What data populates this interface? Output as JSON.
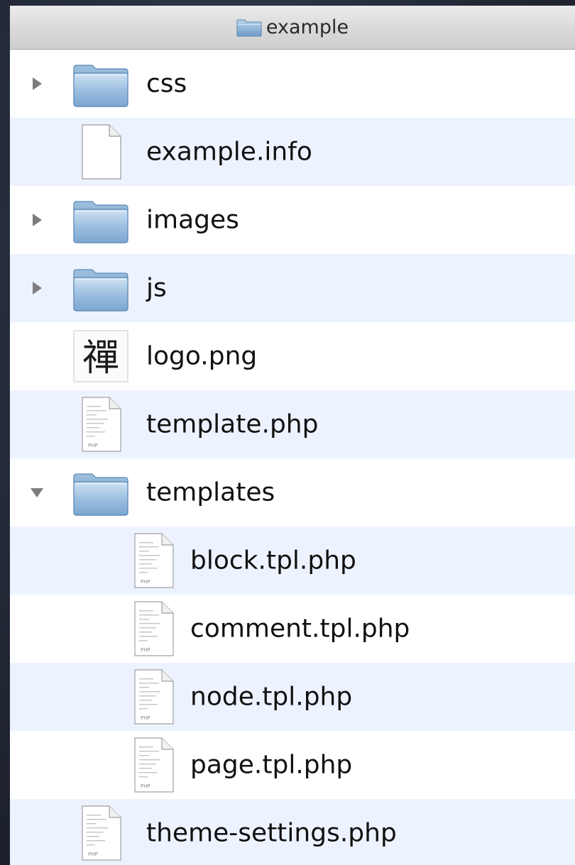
{
  "window": {
    "title": "example",
    "title_icon": "folder-icon"
  },
  "colors": {
    "row_even": "#edf3fe",
    "row_odd": "#ffffff",
    "folder_blue": "#8fb4d6",
    "disclosure": "#7d7d7d"
  },
  "items": [
    {
      "name": "css",
      "kind": "folder",
      "icon": "folder-icon",
      "disclosure": "collapsed",
      "level": 0
    },
    {
      "name": "example.info",
      "kind": "file",
      "icon": "document-icon",
      "disclosure": "none",
      "level": 0
    },
    {
      "name": "images",
      "kind": "folder",
      "icon": "folder-icon",
      "disclosure": "collapsed",
      "level": 0
    },
    {
      "name": "js",
      "kind": "folder",
      "icon": "folder-icon",
      "disclosure": "collapsed",
      "level": 0
    },
    {
      "name": "logo.png",
      "kind": "image",
      "icon": "image-icon",
      "disclosure": "none",
      "level": 0,
      "thumb_glyph": "禪"
    },
    {
      "name": "template.php",
      "kind": "php",
      "icon": "php-file-icon",
      "disclosure": "none",
      "level": 0,
      "badge": "PHP"
    },
    {
      "name": "templates",
      "kind": "folder",
      "icon": "folder-icon",
      "disclosure": "expanded",
      "level": 0
    },
    {
      "name": "block.tpl.php",
      "kind": "php",
      "icon": "php-file-icon",
      "disclosure": "none",
      "level": 1,
      "badge": "PHP"
    },
    {
      "name": "comment.tpl.php",
      "kind": "php",
      "icon": "php-file-icon",
      "disclosure": "none",
      "level": 1,
      "badge": "PHP"
    },
    {
      "name": "node.tpl.php",
      "kind": "php",
      "icon": "php-file-icon",
      "disclosure": "none",
      "level": 1,
      "badge": "PHP"
    },
    {
      "name": "page.tpl.php",
      "kind": "php",
      "icon": "php-file-icon",
      "disclosure": "none",
      "level": 1,
      "badge": "PHP"
    },
    {
      "name": "theme-settings.php",
      "kind": "php",
      "icon": "php-file-icon",
      "disclosure": "none",
      "level": 0,
      "badge": "PHP"
    }
  ]
}
